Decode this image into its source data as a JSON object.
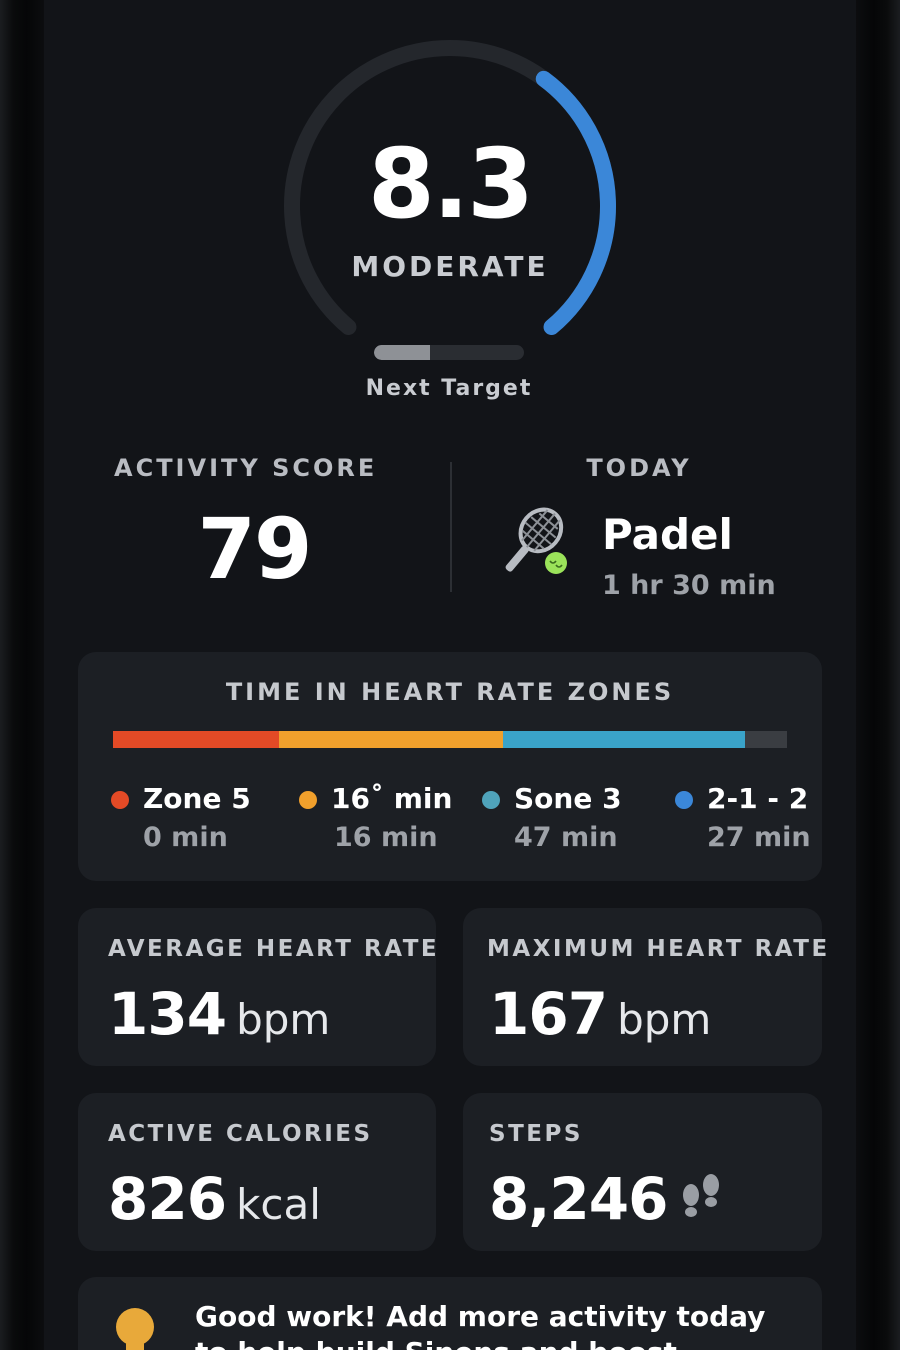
{
  "intensity": {
    "value": "8.3",
    "label": "MODERATE",
    "ring_progress_fraction": 0.37,
    "ring_color": "#3b87d8",
    "next_target_label": "Next Target",
    "next_target_progress_fraction": 0.37
  },
  "activity_score": {
    "title": "ACTIVITY SCORE",
    "value": "79"
  },
  "today": {
    "title": "TODAY",
    "sport": "Padel",
    "duration": "1 hr 30 min",
    "icon": "padel-racket-icon"
  },
  "zones": {
    "title": "TIME IN HEART RATE ZONES",
    "bar_segments": [
      {
        "color": "#e34a26",
        "fraction": 0.247
      },
      {
        "color": "#f1a02c",
        "fraction": 0.331
      },
      {
        "color": "#3aa3c9",
        "fraction": 0.359
      },
      {
        "color": "#3a3d42",
        "fraction": 0.063
      }
    ],
    "legend": [
      {
        "name": "Zone 5",
        "minutes": "0 min",
        "color": "#e34a26"
      },
      {
        "name": "16˚ min",
        "minutes": "16 min",
        "color": "#f1a02c"
      },
      {
        "name": "Sone 3",
        "minutes": "47 min",
        "color": "#4fa3bb"
      },
      {
        "name": "2-1 - 2",
        "minutes": "27 min",
        "color": "#3b87d8"
      }
    ]
  },
  "metrics": {
    "avg_hr": {
      "title": "AVERAGE HEART RATE",
      "value": "134",
      "unit": "bpm"
    },
    "max_hr": {
      "title": "MAXIMUM HEART RATE",
      "value": "167",
      "unit": "bpm"
    },
    "calories": {
      "title": "ACTIVE CALORIES",
      "value": "826",
      "unit": "kcal"
    },
    "steps": {
      "title": "STEPS",
      "value": "8,246",
      "icon": "footprints-icon"
    }
  },
  "tip": {
    "icon": "lightbulb-icon",
    "icon_color": "#e8a93a",
    "text": "Good work! Add more activity today to help build Sinens and boost Barmony."
  }
}
